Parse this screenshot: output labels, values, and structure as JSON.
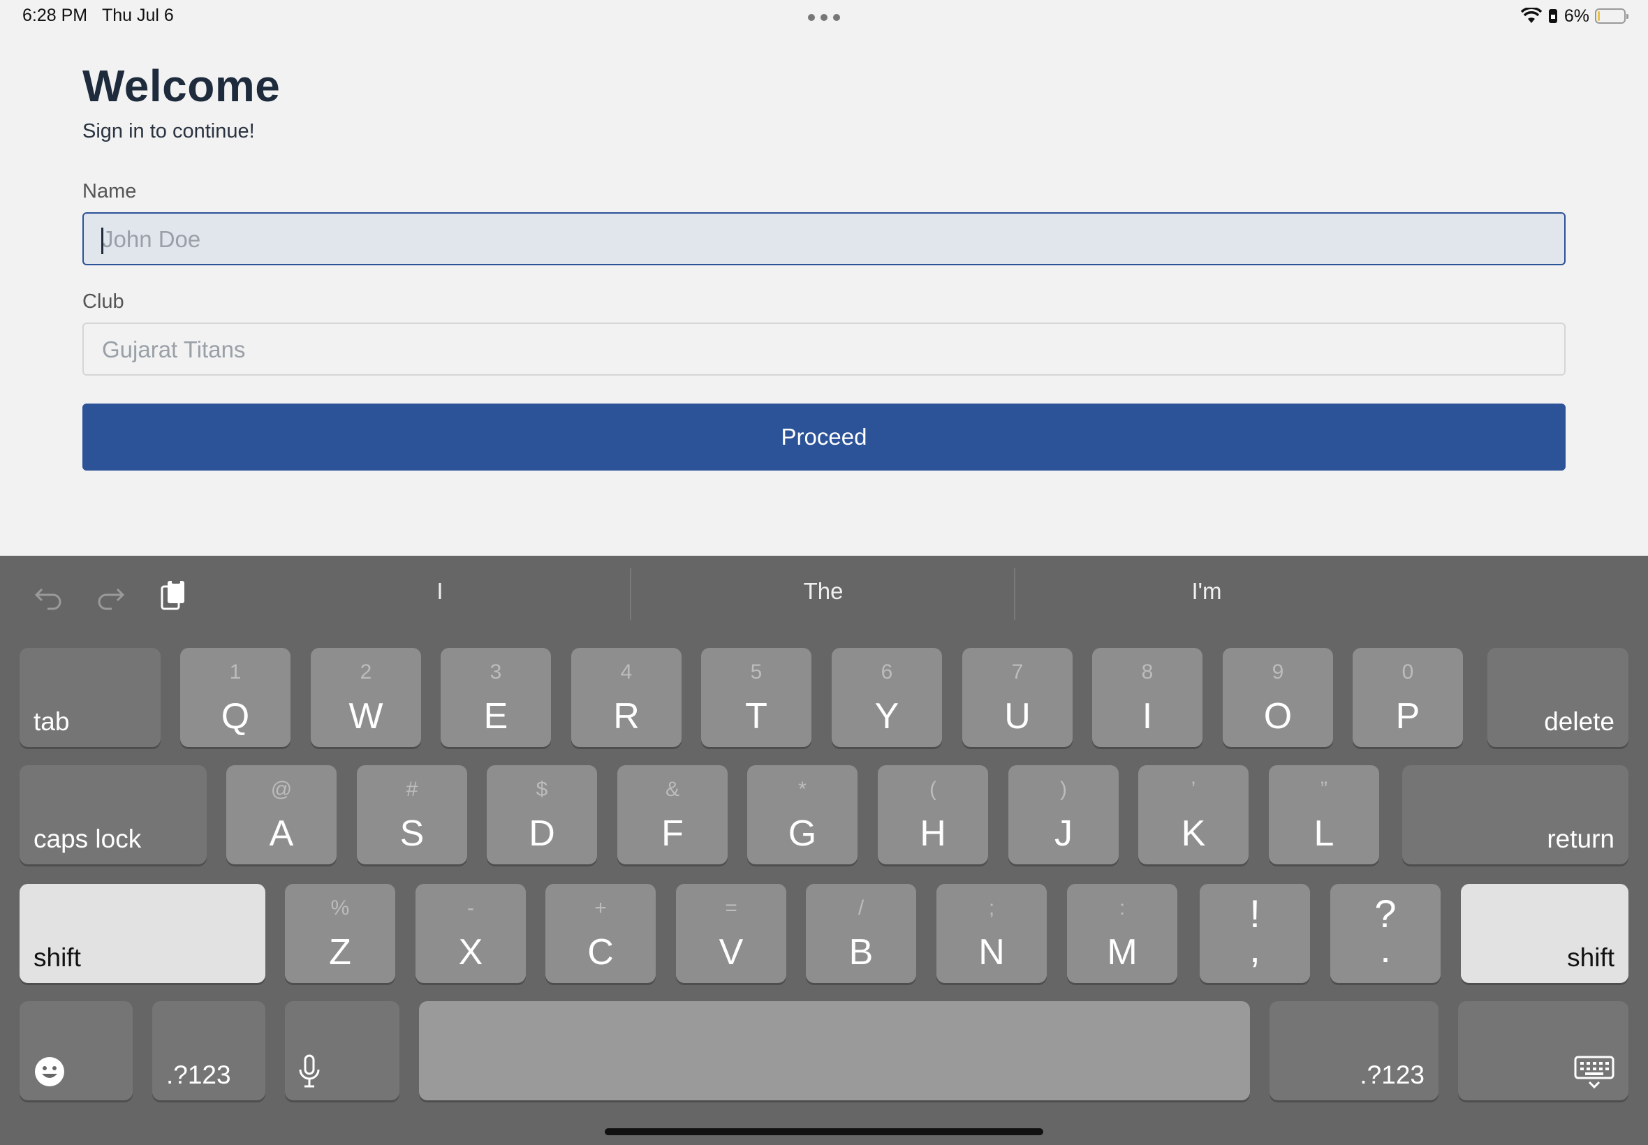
{
  "status_bar": {
    "time": "6:28 PM",
    "date": "Thu Jul 6",
    "battery_percent": "6%",
    "battery_level": 0.06
  },
  "form": {
    "title": "Welcome",
    "subtitle": "Sign in to continue!",
    "name_label": "Name",
    "name_placeholder": "John Doe",
    "club_label": "Club",
    "club_placeholder": "Gujarat Titans",
    "proceed_label": "Proceed"
  },
  "keyboard": {
    "suggestions": [
      "I",
      "The",
      "I'm"
    ],
    "row1": {
      "tab": "tab",
      "keys": [
        [
          "Q",
          "1"
        ],
        [
          "W",
          "2"
        ],
        [
          "E",
          "3"
        ],
        [
          "R",
          "4"
        ],
        [
          "T",
          "5"
        ],
        [
          "Y",
          "6"
        ],
        [
          "U",
          "7"
        ],
        [
          "I",
          "8"
        ],
        [
          "O",
          "9"
        ],
        [
          "P",
          "0"
        ]
      ],
      "delete": "delete"
    },
    "row2": {
      "caps": "caps lock",
      "keys": [
        [
          "A",
          "@"
        ],
        [
          "S",
          "#"
        ],
        [
          "D",
          "$"
        ],
        [
          "F",
          "&"
        ],
        [
          "G",
          "*"
        ],
        [
          "H",
          "("
        ],
        [
          "J",
          ")"
        ],
        [
          "K",
          "’"
        ],
        [
          "L",
          "”"
        ]
      ],
      "return": "return"
    },
    "row3": {
      "shift": "shift",
      "keys": [
        [
          "Z",
          "%"
        ],
        [
          "X",
          "-"
        ],
        [
          "C",
          "+"
        ],
        [
          "V",
          "="
        ],
        [
          "B",
          "/"
        ],
        [
          "N",
          ";"
        ],
        [
          "M",
          ":"
        ]
      ],
      "punct": [
        [
          "!",
          ","
        ],
        [
          "?",
          "."
        ]
      ]
    },
    "row4": {
      "numbers": ".?123"
    }
  },
  "colors": {
    "accent": "#2c5298",
    "heading": "#1e2b3c",
    "keyboard_bg": "#666666"
  }
}
